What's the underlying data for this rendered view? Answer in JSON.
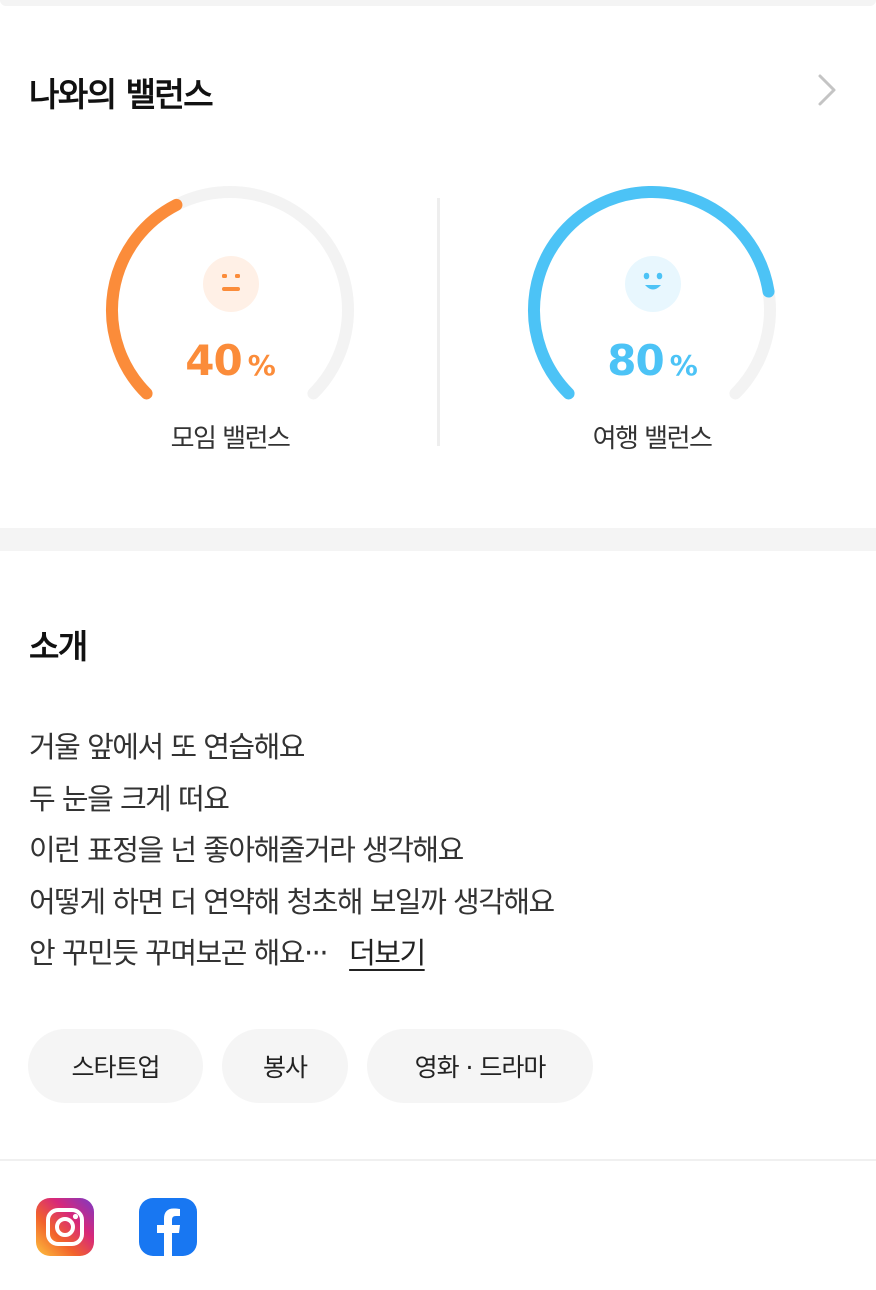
{
  "balance": {
    "title": "나와의 밸런스",
    "gauges": [
      {
        "label": "모임 밸런스",
        "value": "40",
        "unit": "%",
        "percent": 40,
        "color": "#fb8c3a",
        "face_bg": "#fff0e6",
        "face_icon": "neutral-face-icon"
      },
      {
        "label": "여행 밸런스",
        "value": "80",
        "unit": "%",
        "percent": 80,
        "color": "#4cc3f6",
        "face_bg": "#e8f7fe",
        "face_icon": "smile-face-icon"
      }
    ],
    "track_color": "#f3f3f3"
  },
  "intro": {
    "title": "소개",
    "lines": [
      "거울 앞에서 또 연습해요",
      "두 눈을 크게 떠요",
      "이런 표정을 넌 좋아해줄거라 생각해요",
      "어떻게 하면 더 연약해 청초해 보일까 생각해요",
      "안 꾸민듯 꾸며보곤 해요···"
    ],
    "more_label": "더보기"
  },
  "tags": [
    "스타트업",
    "봉사",
    "영화 · 드라마"
  ],
  "social": [
    {
      "name": "instagram",
      "icon": "instagram-icon"
    },
    {
      "name": "facebook",
      "icon": "facebook-icon"
    }
  ]
}
